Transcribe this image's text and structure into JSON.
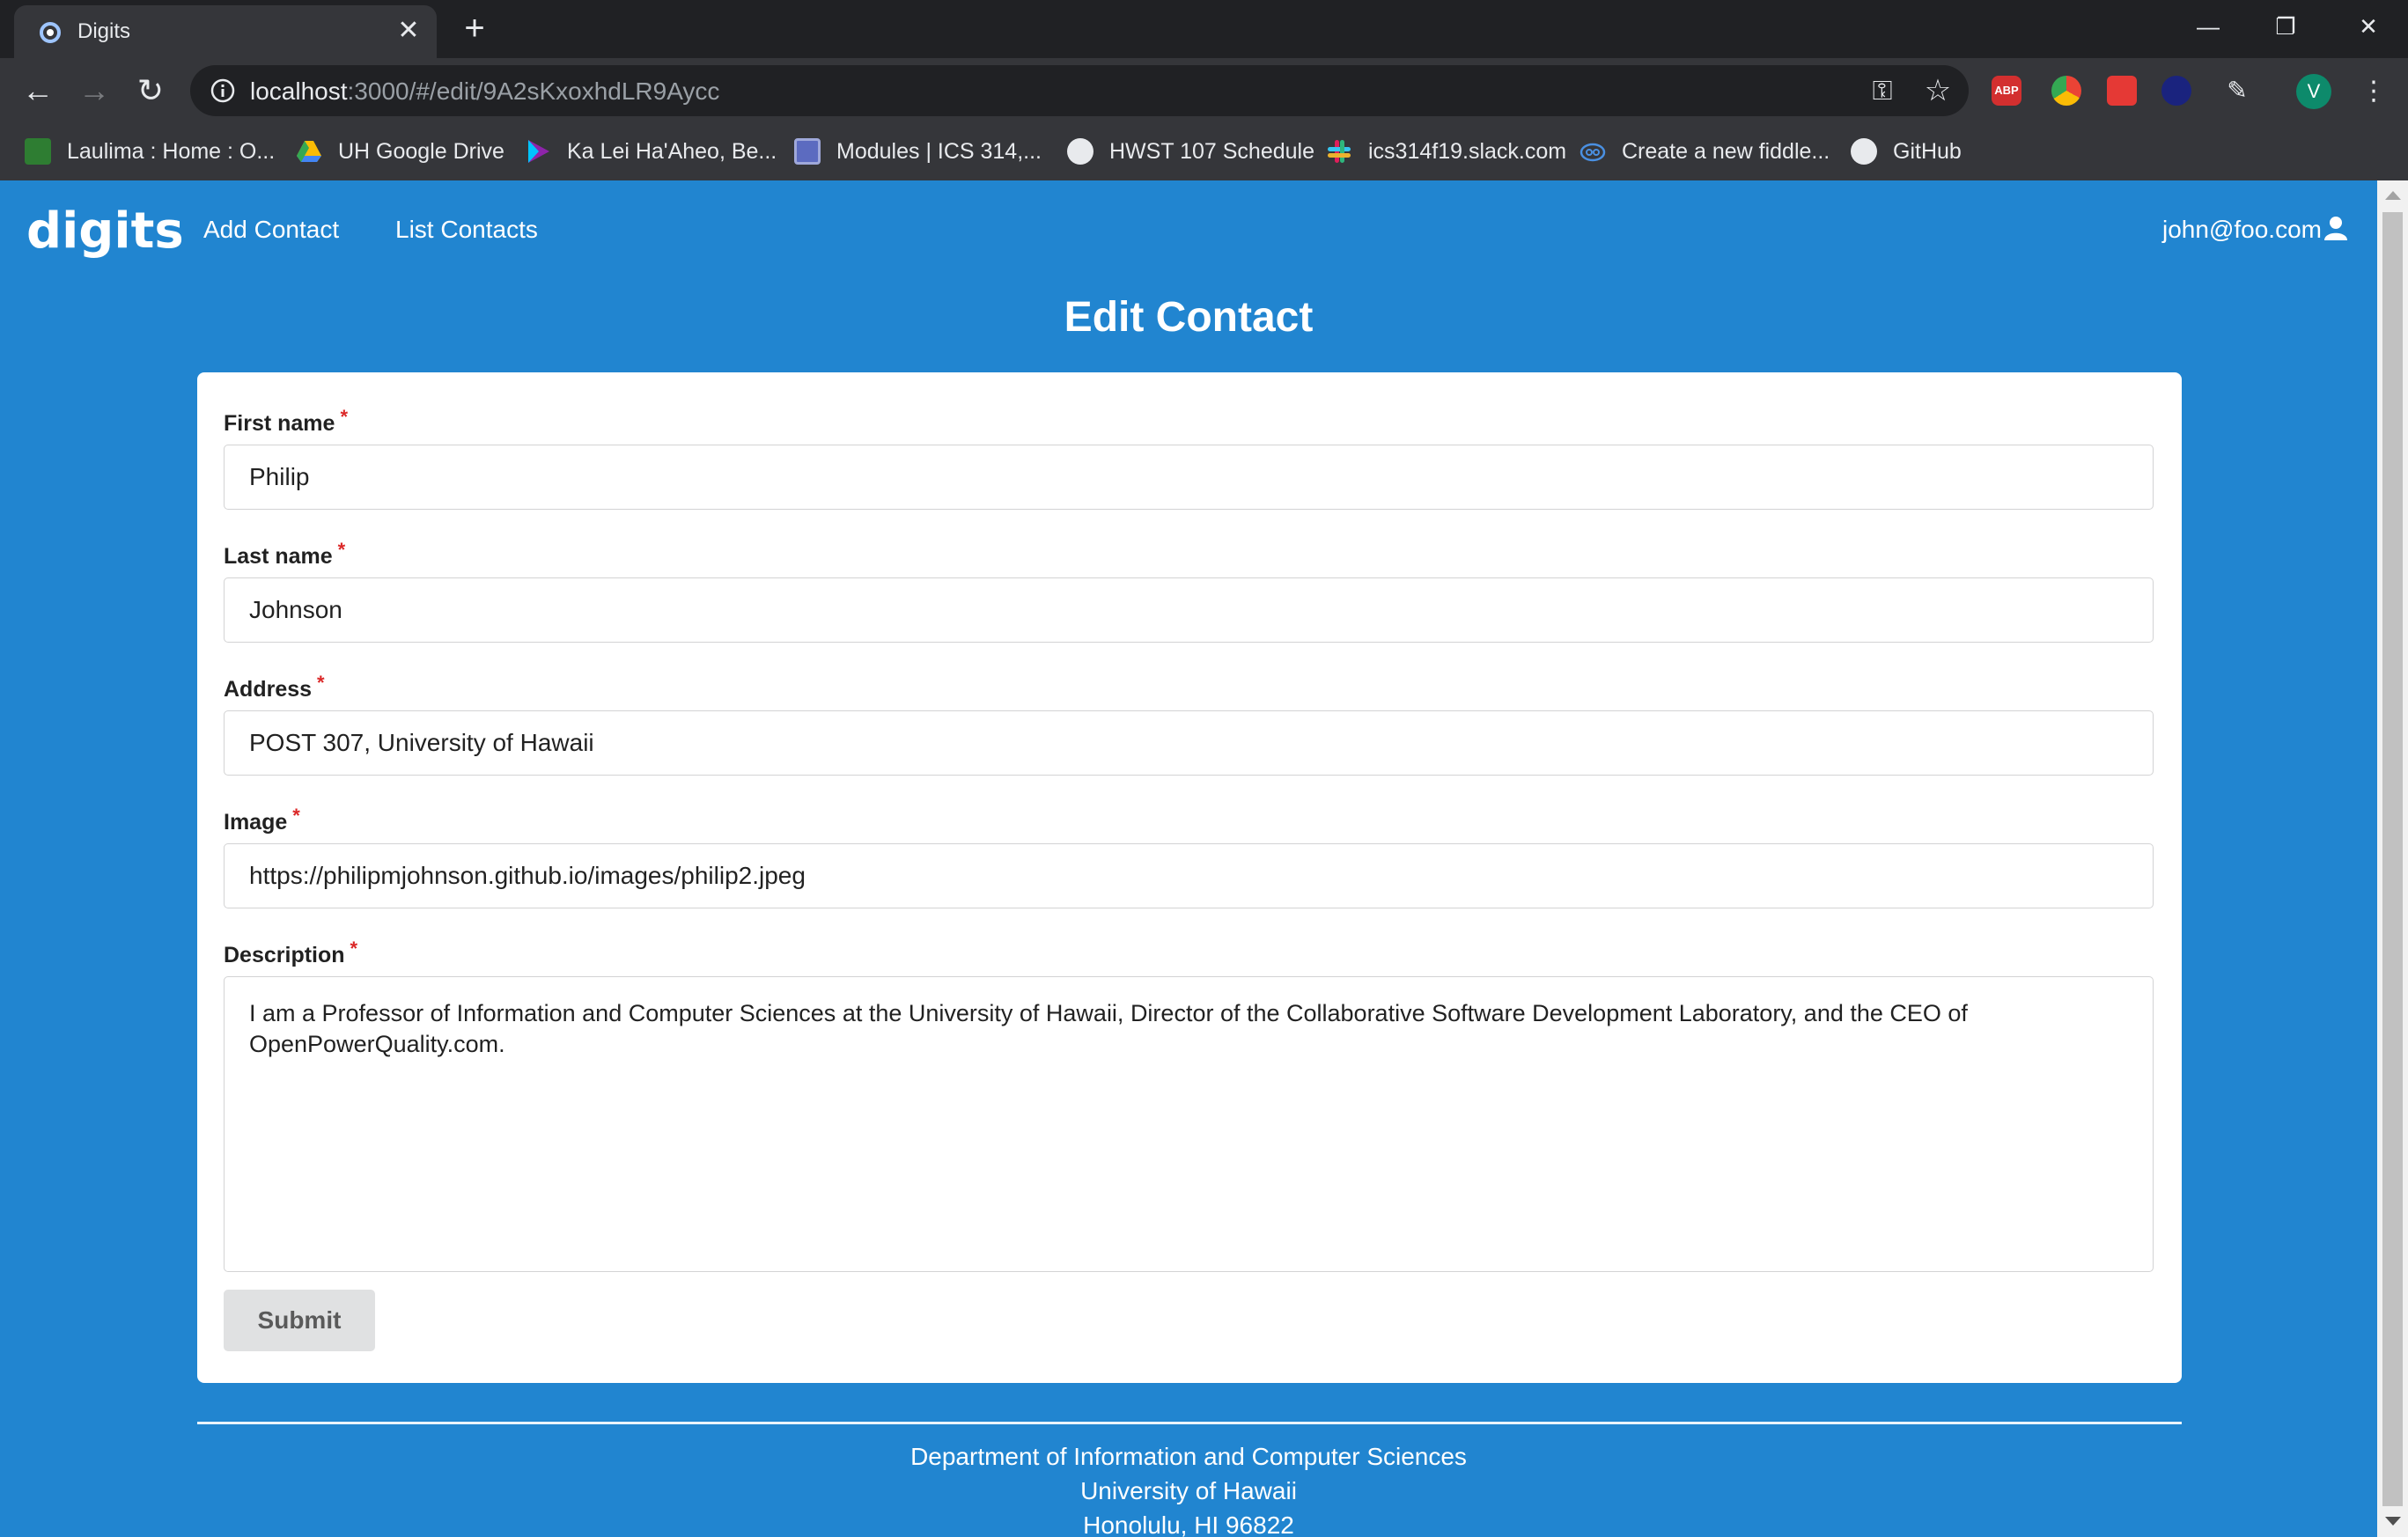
{
  "browser": {
    "tab_title": "Digits",
    "url_host": "localhost",
    "url_rest": ":3000/#/edit/9A2sKxoxhdLR9Aycc",
    "profile_initial": "V",
    "extensions": {
      "abp_label": "ABP"
    },
    "bookmarks": [
      {
        "label": "Laulima : Home : O...",
        "icon": "laulima-icon",
        "color": "#2e7d32"
      },
      {
        "label": "UH Google Drive",
        "icon": "google-drive-icon",
        "color": "#fbbc05"
      },
      {
        "label": "Ka Lei Ha'Aheo, Be...",
        "icon": "play-icon",
        "color": "#8e24aa"
      },
      {
        "label": "Modules | ICS 314,...",
        "icon": "modules-icon",
        "color": "#5c6bc0"
      },
      {
        "label": "HWST 107 Schedule",
        "icon": "globe-icon",
        "color": "#e8eaed"
      },
      {
        "label": "ics314f19.slack.com",
        "icon": "slack-icon",
        "color": "#e01e5a"
      },
      {
        "label": "Create a new fiddle...",
        "icon": "jsfiddle-icon",
        "color": "#4a90e2"
      },
      {
        "label": "GitHub",
        "icon": "github-icon",
        "color": "#e8eaed"
      }
    ]
  },
  "navbar": {
    "brand": "digits",
    "links": [
      "Add Contact",
      "List Contacts"
    ],
    "user": "john@foo.com"
  },
  "form": {
    "title": "Edit Contact",
    "required_marker": "*",
    "fields": [
      {
        "label": "First name",
        "value": "Philip"
      },
      {
        "label": "Last name",
        "value": "Johnson"
      },
      {
        "label": "Address",
        "value": "POST 307, University of Hawaii"
      },
      {
        "label": "Image",
        "value": "https://philipmjohnson.github.io/images/philip2.jpeg"
      }
    ],
    "description": {
      "label": "Description",
      "value": "I am a Professor of Information and Computer Sciences at the University of Hawaii, Director of the Collaborative Software Development Laboratory, and the CEO of OpenPowerQuality.com."
    },
    "submit_label": "Submit"
  },
  "footer": {
    "lines": [
      "Department of Information and Computer Sciences",
      "University of Hawaii",
      "Honolulu, HI 96822"
    ]
  },
  "colors": {
    "page_bg": "#2185d0",
    "required": "#db2828"
  }
}
